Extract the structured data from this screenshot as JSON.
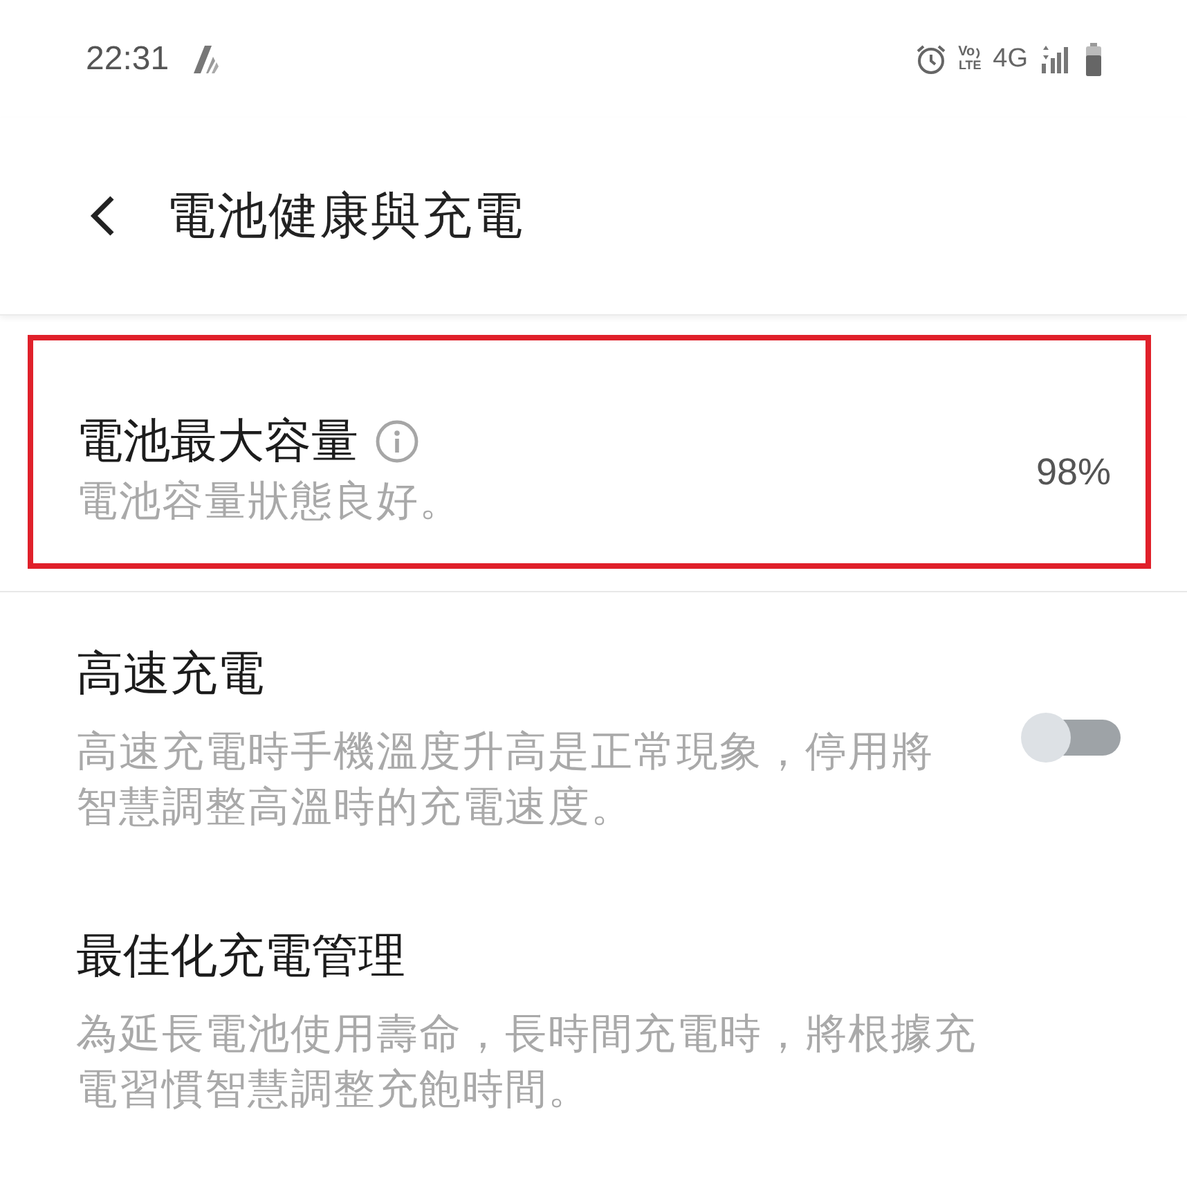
{
  "status_bar": {
    "time": "22:31",
    "volte_top": "Vo",
    "volte_bottom": "LTE",
    "network": "4G"
  },
  "header": {
    "title": "電池健康與充電"
  },
  "items": [
    {
      "kind": "value",
      "title": "電池最大容量",
      "info": true,
      "description": "電池容量狀態良好。",
      "value": "98%",
      "highlighted": true,
      "divider": true
    },
    {
      "kind": "toggle",
      "title": "高速充電",
      "description": "高速充電時手機溫度升高是正常現象，停用將智慧調整高溫時的充電速度。",
      "on": false,
      "highlighted": false
    },
    {
      "kind": "plain",
      "title": "最佳化充電管理",
      "description": "為延長電池使用壽命，長時間充電時，將根據充電習慣智慧調整充飽時間。",
      "highlighted": false
    }
  ]
}
